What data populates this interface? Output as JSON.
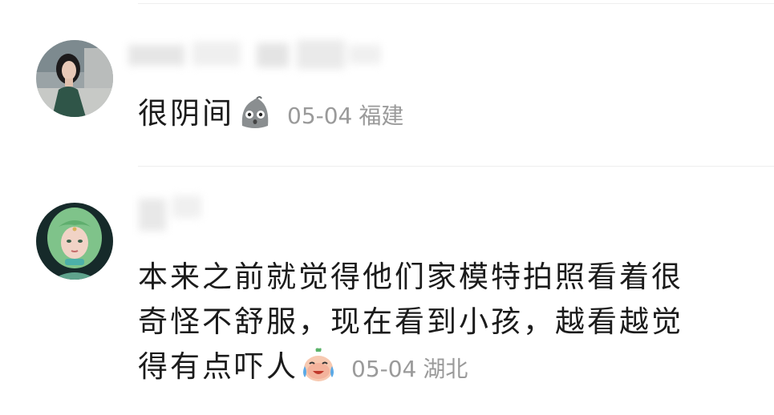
{
  "comments": [
    {
      "avatar": "avatar-photo-woman",
      "lines": [
        "很阴间"
      ],
      "emoji": "ghost-emoji",
      "time": "05-04",
      "location": "福建"
    },
    {
      "avatar": "avatar-green-hair-illustration",
      "lines": [
        "本来之前就觉得他们家模特拍照看着很",
        "奇怪不舒服，现在看到小孩，越看越觉",
        "得有点吓人"
      ],
      "emoji": "crying-emoji",
      "time": "05-04",
      "location": "湖北"
    }
  ]
}
